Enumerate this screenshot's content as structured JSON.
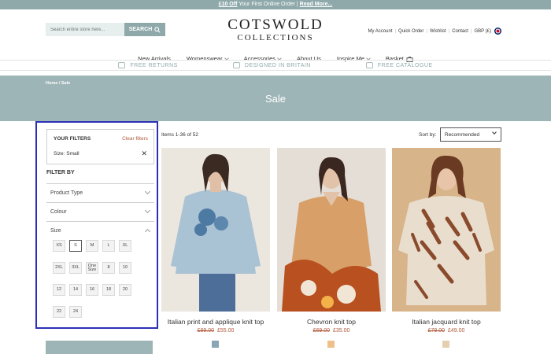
{
  "promo": {
    "highlight": "£10 Off",
    "text": " Your First Online Order | ",
    "link": "Read More..."
  },
  "header": {
    "search_placeholder": "Search entire store here...",
    "search_label": "SEARCH",
    "logo_line1": "COTSWOLD",
    "logo_line2": "COLLECTIONS",
    "util_links": [
      "My Account",
      "Quick Order",
      "Wishlist",
      "Contact"
    ],
    "currency": "GBP (£)"
  },
  "nav": {
    "items": [
      {
        "label": "New Arrivals",
        "has_dropdown": false
      },
      {
        "label": "Womenswear",
        "has_dropdown": true
      },
      {
        "label": "Accessories",
        "has_dropdown": true
      },
      {
        "label": "About Us",
        "has_dropdown": false
      },
      {
        "label": "Inspire Me",
        "has_dropdown": true
      },
      {
        "label": "Basket",
        "has_dropdown": false
      }
    ]
  },
  "benefits": [
    "FREE RETURNS",
    "DESIGNED IN BRITAIN",
    "FREE CATALOGUE"
  ],
  "hero": {
    "breadcrumb": "Home  /  Sale",
    "title": "Sale"
  },
  "filters": {
    "your_filters_title": "YOUR FILTERS",
    "clear_label": "Clear filters",
    "applied": "Size: Small",
    "filter_by": "FILTER BY",
    "facets": [
      "Product Type",
      "Colour",
      "Size"
    ],
    "sizes": [
      "XS",
      "S",
      "M",
      "L",
      "XL",
      "2XL",
      "3XL",
      "One Size",
      "8",
      "10",
      "12",
      "14",
      "16",
      "18",
      "20",
      "22",
      "24"
    ],
    "selected_size": "S"
  },
  "listing": {
    "items_count": "Items 1-36 of 52",
    "sort_label": "Sort by:",
    "sort_value": "Recommended"
  },
  "products": [
    {
      "name": "Italian print and applique knit top",
      "was": "£89.00",
      "now": "£55.00",
      "swatch": "#8aa5b5"
    },
    {
      "name": "Chevron knit top",
      "was": "£69.00",
      "now": "£35.00",
      "swatch": "#f0c08a"
    },
    {
      "name": "Italian jacquard knit top",
      "was": "£79.00",
      "now": "£49.00",
      "swatch": "#e6cfb0"
    }
  ],
  "colors": {
    "accent": "#8fa9ab",
    "hero": "#9eb5b7",
    "price": "#b05a3c",
    "highlight_border": "#2b2fb5"
  }
}
